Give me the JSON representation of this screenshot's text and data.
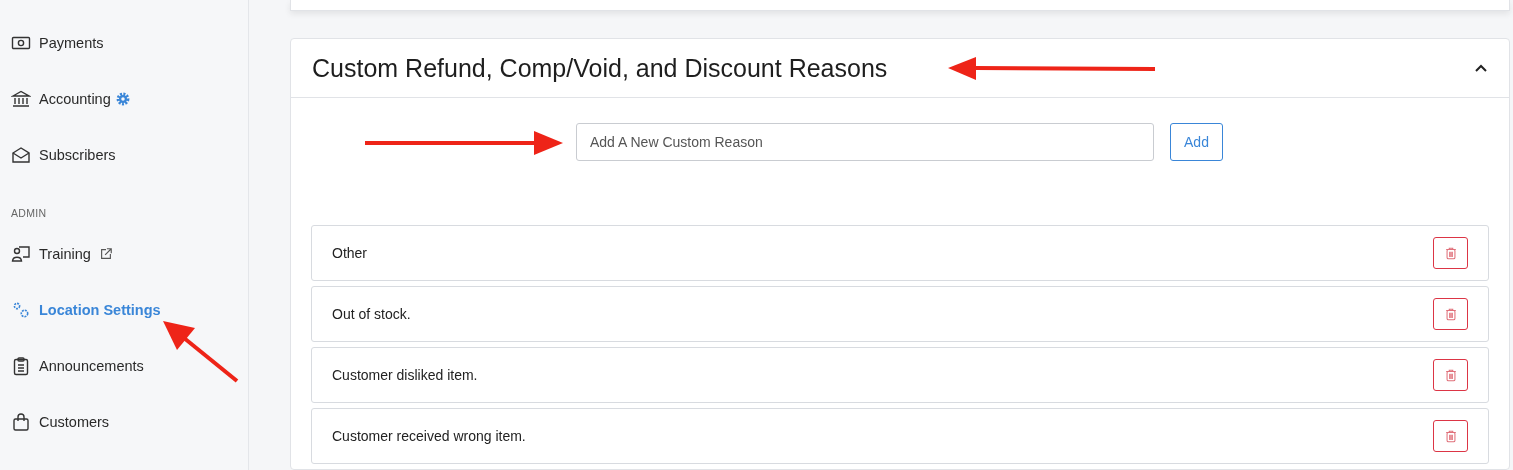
{
  "sidebar": {
    "items": [
      {
        "kind": "item",
        "label": "Payments",
        "selected": false,
        "external": false,
        "settings": false
      },
      {
        "kind": "item",
        "label": "Accounting",
        "selected": false,
        "external": false,
        "settings": true
      },
      {
        "kind": "item",
        "label": "Subscribers",
        "selected": false,
        "external": false,
        "settings": false
      },
      {
        "kind": "heading",
        "label": "ADMIN"
      },
      {
        "kind": "item",
        "label": "Training",
        "selected": false,
        "external": true,
        "settings": false
      },
      {
        "kind": "item",
        "label": "Location Settings",
        "selected": true,
        "external": false,
        "settings": false
      },
      {
        "kind": "item",
        "label": "Announcements",
        "selected": false,
        "external": false,
        "settings": false
      },
      {
        "kind": "item",
        "label": "Customers",
        "selected": false,
        "external": false,
        "settings": false
      }
    ]
  },
  "section": {
    "title": "Custom Refund, Comp/Void, and Discount Reasons",
    "expanded": true,
    "new_reason": {
      "placeholder": "Add A New Custom Reason"
    },
    "add_button": "Add",
    "reasons": [
      "Other",
      "Out of stock.",
      "Customer disliked item.",
      "Customer received wrong item."
    ]
  }
}
